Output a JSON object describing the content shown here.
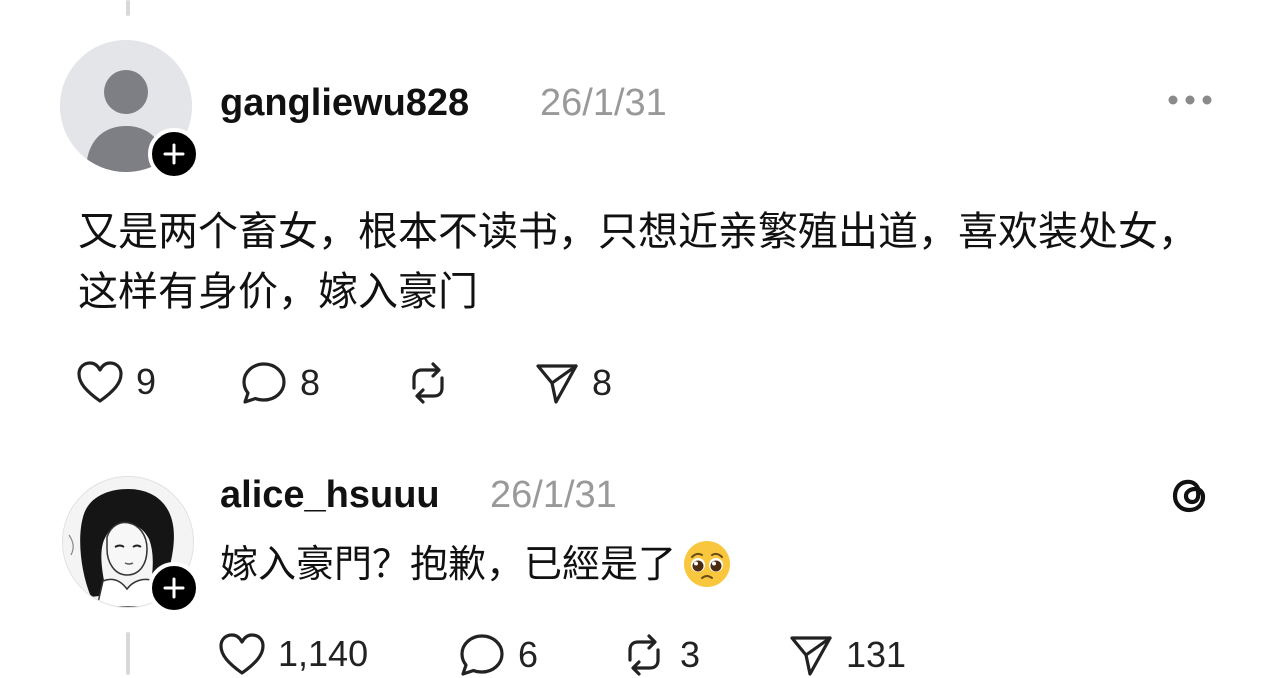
{
  "post": {
    "username": "gangliewu828",
    "date": "26/1/31",
    "text": "又是两个畜女，根本不读书，只想近亲繁殖出道，喜欢装处女，这样有身价，嫁入豪门",
    "actions": {
      "likes": "9",
      "comments": "8",
      "reposts": "",
      "shares": "8"
    },
    "avatar_icon": "default-user-icon",
    "follow_icon": "plus-icon",
    "menu_icon": "more-dots-icon"
  },
  "reply": {
    "username": "alice_hsuuu",
    "date": "26/1/31",
    "text": "嫁入豪門？抱歉，已經是了",
    "emoji_icon": "pleading-face-emoji",
    "actions": {
      "likes": "1,140",
      "comments": "6",
      "reposts": "3",
      "shares": "131"
    },
    "avatar_icon": "user-photo",
    "follow_icon": "plus-icon",
    "brand_icon": "threads-logo-icon"
  },
  "colors": {
    "text": "#111111",
    "date": "#999999",
    "thread_line": "#d9d9d9",
    "badge": "#000000"
  }
}
